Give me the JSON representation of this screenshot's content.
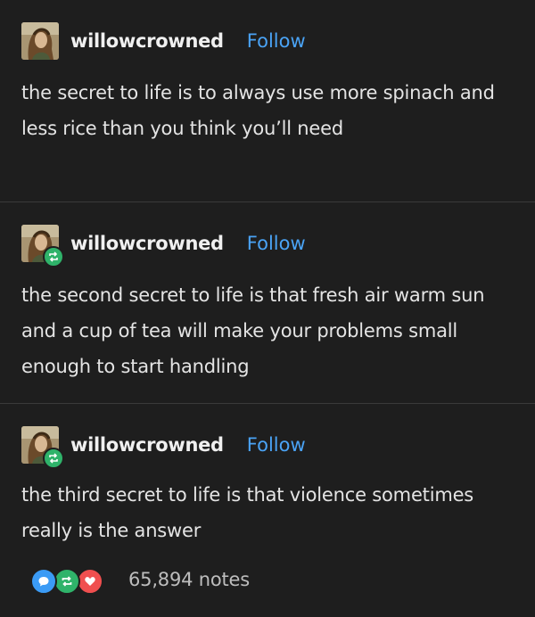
{
  "posts": [
    {
      "username": "willowcrowned",
      "follow_label": "Follow",
      "is_reblog": false,
      "text": "the secret to life is to always use more spinach and less rice than you think you’ll need"
    },
    {
      "username": "willowcrowned",
      "follow_label": "Follow",
      "is_reblog": true,
      "text": "the second secret to life is that fresh air warm sun and a cup of tea will make your problems small enough to start handling"
    },
    {
      "username": "willowcrowned",
      "follow_label": "Follow",
      "is_reblog": true,
      "text": "the third secret to life is that violence sometimes really is the answer"
    }
  ],
  "notes": {
    "count": "65,894 notes",
    "icons": [
      "reply-icon",
      "reblog-icon",
      "like-icon"
    ]
  },
  "colors": {
    "background": "#1e1e1e",
    "follow": "#4aa3f5",
    "reply": "#3b9bf5",
    "reblog": "#2fb36a",
    "like": "#f04f4f"
  }
}
